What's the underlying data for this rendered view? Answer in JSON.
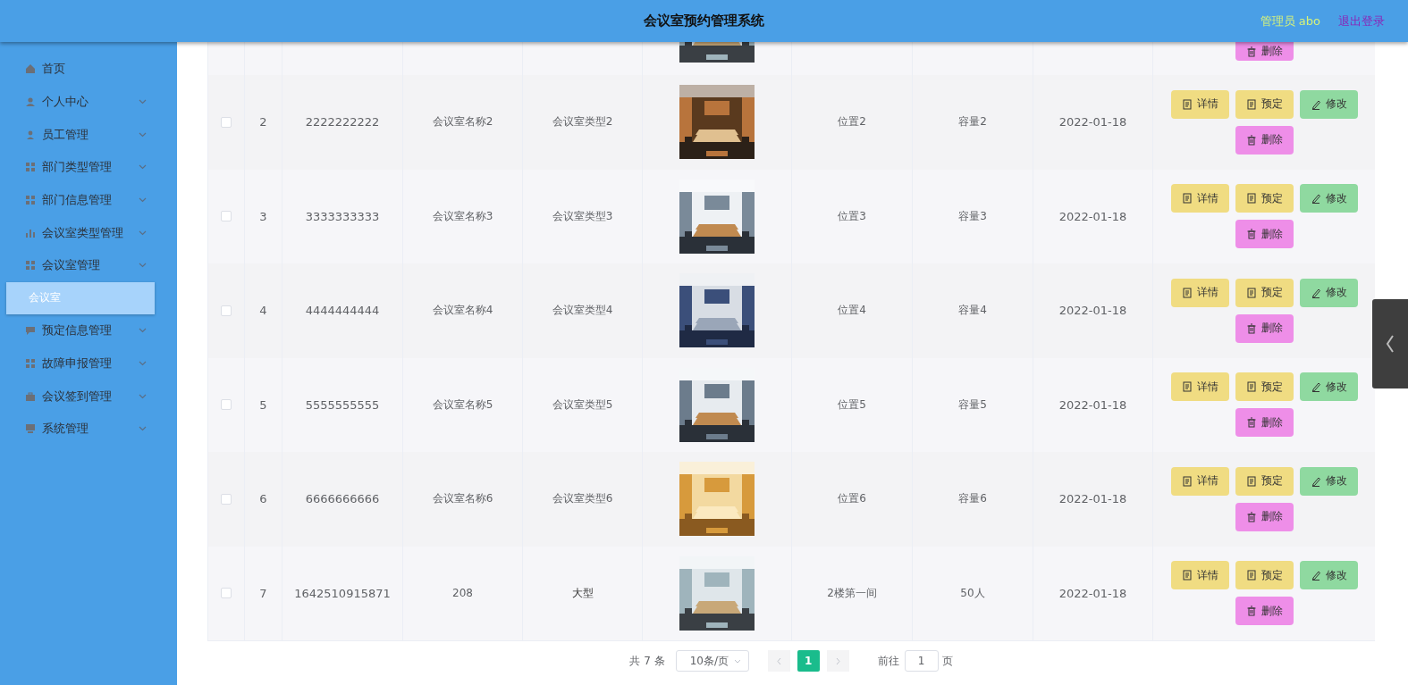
{
  "header": {
    "title": "会议室预约管理系统",
    "user": "管理员 abo",
    "logout": "退出登录"
  },
  "sidebar": {
    "items": [
      {
        "label": "首页",
        "expandable": false,
        "selected": false
      },
      {
        "label": "个人中心",
        "expandable": true,
        "selected": false
      },
      {
        "label": "员工管理",
        "expandable": true,
        "selected": false
      },
      {
        "label": "部门类型管理",
        "expandable": true,
        "selected": false
      },
      {
        "label": "部门信息管理",
        "expandable": true,
        "selected": false
      },
      {
        "label": "会议室类型管理",
        "expandable": true,
        "selected": false
      },
      {
        "label": "会议室管理",
        "expandable": true,
        "selected": false,
        "children": [
          {
            "label": "会议室",
            "selected": true
          }
        ]
      },
      {
        "label": "预定信息管理",
        "expandable": true,
        "selected": false
      },
      {
        "label": "故障申报管理",
        "expandable": true,
        "selected": false
      },
      {
        "label": "会议签到管理",
        "expandable": true,
        "selected": false
      },
      {
        "label": "系统管理",
        "expandable": true,
        "selected": false
      }
    ]
  },
  "table": {
    "rows": [
      {
        "kind": "cut",
        "actions": [
          {
            "kind": "delete",
            "label": "删除"
          }
        ]
      },
      {
        "kind": "full",
        "checked": false,
        "index": "2",
        "number": "2222222222",
        "name": "会议室名称2",
        "type": "会议室类型2",
        "location": "位置2",
        "capacity": "容量2",
        "date": "2022-01-18",
        "actions": [
          {
            "kind": "detail",
            "label": "详情"
          },
          {
            "kind": "book",
            "label": "预定"
          },
          {
            "kind": "edit",
            "label": "修改"
          },
          {
            "kind": "delete",
            "label": "删除"
          }
        ]
      },
      {
        "kind": "full",
        "checked": false,
        "index": "3",
        "number": "3333333333",
        "name": "会议室名称3",
        "type": "会议室类型3",
        "location": "位置3",
        "capacity": "容量3",
        "date": "2022-01-18",
        "actions": [
          {
            "kind": "detail",
            "label": "详情"
          },
          {
            "kind": "book",
            "label": "预定"
          },
          {
            "kind": "edit",
            "label": "修改"
          },
          {
            "kind": "delete",
            "label": "删除"
          }
        ]
      },
      {
        "kind": "full",
        "checked": false,
        "index": "4",
        "number": "4444444444",
        "name": "会议室名称4",
        "type": "会议室类型4",
        "location": "位置4",
        "capacity": "容量4",
        "date": "2022-01-18",
        "actions": [
          {
            "kind": "detail",
            "label": "详情"
          },
          {
            "kind": "book",
            "label": "预定"
          },
          {
            "kind": "edit",
            "label": "修改"
          },
          {
            "kind": "delete",
            "label": "删除"
          }
        ]
      },
      {
        "kind": "full",
        "checked": false,
        "index": "5",
        "number": "5555555555",
        "name": "会议室名称5",
        "type": "会议室类型5",
        "location": "位置5",
        "capacity": "容量5",
        "date": "2022-01-18",
        "actions": [
          {
            "kind": "detail",
            "label": "详情"
          },
          {
            "kind": "book",
            "label": "预定"
          },
          {
            "kind": "edit",
            "label": "修改"
          },
          {
            "kind": "delete",
            "label": "删除"
          }
        ]
      },
      {
        "kind": "full",
        "checked": false,
        "index": "6",
        "number": "6666666666",
        "name": "会议室名称6",
        "type": "会议室类型6",
        "location": "位置6",
        "capacity": "容量6",
        "date": "2022-01-18",
        "actions": [
          {
            "kind": "detail",
            "label": "详情"
          },
          {
            "kind": "book",
            "label": "预定"
          },
          {
            "kind": "edit",
            "label": "修改"
          },
          {
            "kind": "delete",
            "label": "删除"
          }
        ]
      },
      {
        "kind": "full",
        "checked": false,
        "index": "7",
        "number": "1642510915871",
        "name": "208",
        "type": "大型",
        "location": "2楼第一间",
        "capacity": "50人",
        "date": "2022-01-18",
        "actions": [
          {
            "kind": "detail",
            "label": "详情"
          },
          {
            "kind": "book",
            "label": "预定"
          },
          {
            "kind": "edit",
            "label": "修改"
          },
          {
            "kind": "delete",
            "label": "删除"
          }
        ]
      }
    ]
  },
  "pagination": {
    "total": "共 7 条",
    "page_size": "10条/页",
    "pages": [
      {
        "label": "1",
        "selected": true
      }
    ],
    "goto_label": "前往",
    "goto_value": "1",
    "goto_suffix": "页"
  }
}
